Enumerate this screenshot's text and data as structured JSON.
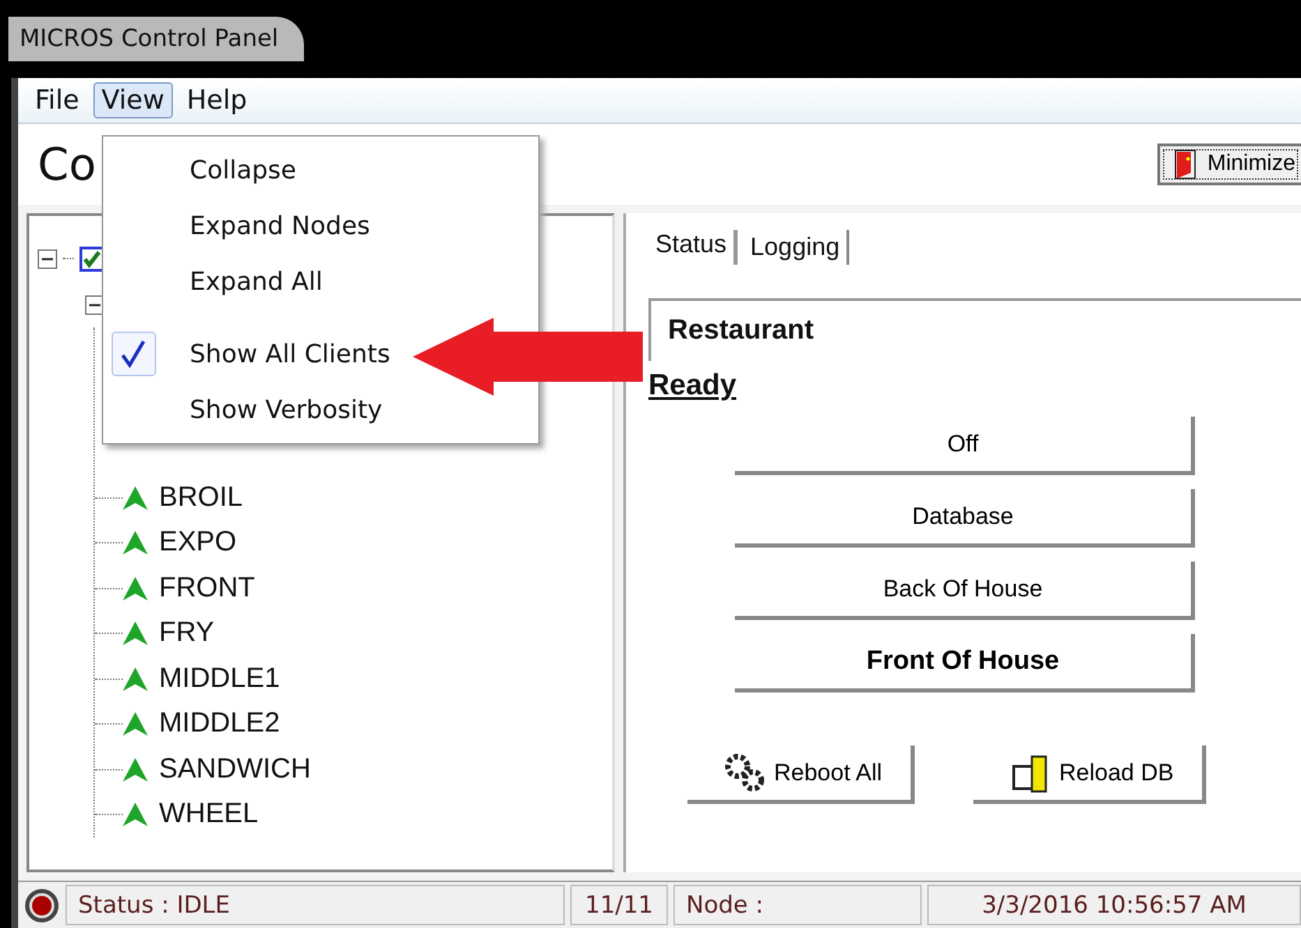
{
  "window": {
    "title": "MICROS Control Panel"
  },
  "menu_bar": [
    {
      "label": "File",
      "selected": false
    },
    {
      "label": "View",
      "selected": true
    },
    {
      "label": "Help",
      "selected": false
    }
  ],
  "view_menu": {
    "groups": [
      [
        {
          "label": "Collapse",
          "checked": false
        },
        {
          "label": "Expand Nodes",
          "checked": false
        },
        {
          "label": "Expand All",
          "checked": false
        }
      ],
      [
        {
          "label": "Show All Clients",
          "checked": true
        },
        {
          "label": "Show Verbosity",
          "checked": false
        }
      ]
    ]
  },
  "header": {
    "title": "Co",
    "minimize_button": "Minimize"
  },
  "tree": {
    "expanded": true,
    "checked": true,
    "children": [
      {
        "expanded": true,
        "children": [
          {
            "label": "BROIL"
          },
          {
            "label": "EXPO"
          },
          {
            "label": "FRONT"
          },
          {
            "label": "FRY"
          },
          {
            "label": "MIDDLE1"
          },
          {
            "label": "MIDDLE2"
          },
          {
            "label": "SANDWICH"
          },
          {
            "label": "WHEEL"
          }
        ]
      }
    ]
  },
  "tabs": [
    {
      "label": "Status",
      "selected": true
    },
    {
      "label": "Logging",
      "selected": false
    }
  ],
  "status_panel": {
    "name": "Restaurant",
    "state": "Ready",
    "buttons": [
      {
        "label": "Off",
        "active": false
      },
      {
        "label": "Database",
        "active": false
      },
      {
        "label": "Back Of House",
        "active": false
      },
      {
        "label": "Front Of House",
        "active": true
      }
    ],
    "actions": [
      {
        "label": "Reboot All",
        "kind": "reboot"
      },
      {
        "label": "Reload DB",
        "kind": "reload"
      }
    ]
  },
  "status_bar": {
    "status": "Status : IDLE",
    "count": "11/11",
    "node": "Node :",
    "datetime": "3/3/2016 10:56:57 AM"
  }
}
